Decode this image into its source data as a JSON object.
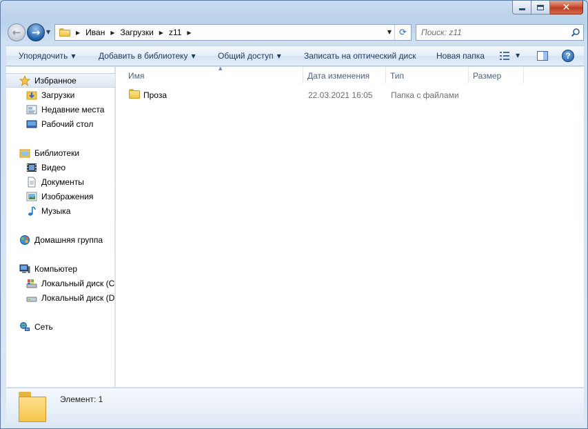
{
  "window": {
    "close_glyph": "✕"
  },
  "nav": {
    "back_glyph": "←",
    "forward_glyph": "→",
    "dropdown_glyph": "▼"
  },
  "address": {
    "crumbs": [
      "Иван",
      "Загрузки",
      "z11"
    ],
    "separator": "▶",
    "dropdown_glyph": "▼",
    "refresh_glyph": "⟳"
  },
  "search": {
    "placeholder": "Поиск: z11"
  },
  "toolbar": {
    "organize": "Упорядочить",
    "add_to_library": "Добавить в библиотеку",
    "share": "Общий доступ",
    "burn": "Записать на оптический диск",
    "new_folder": "Новая папка",
    "arrow": "▼",
    "help": "?"
  },
  "sidebar": {
    "favorites": {
      "label": "Избранное",
      "items": [
        "Загрузки",
        "Недавние места",
        "Рабочий стол"
      ]
    },
    "libraries": {
      "label": "Библиотеки",
      "items": [
        "Видео",
        "Документы",
        "Изображения",
        "Музыка"
      ]
    },
    "homegroup": {
      "label": "Домашняя группа"
    },
    "computer": {
      "label": "Компьютер",
      "items": [
        "Локальный диск (C",
        "Локальный диск (D"
      ]
    },
    "network": {
      "label": "Сеть"
    }
  },
  "columns": {
    "name": "Имя",
    "date": "Дата изменения",
    "type": "Тип",
    "size": "Размер",
    "sort_glyph": "▲"
  },
  "files": [
    {
      "name": "Проза",
      "date": "22.03.2021 16:05",
      "type": "Папка с файлами",
      "size": ""
    }
  ],
  "details": {
    "text": "Элемент: 1"
  },
  "colors": {
    "frame": "#bcd3ea",
    "close_button": "#c74a2f",
    "folder": "#f2c54b"
  }
}
